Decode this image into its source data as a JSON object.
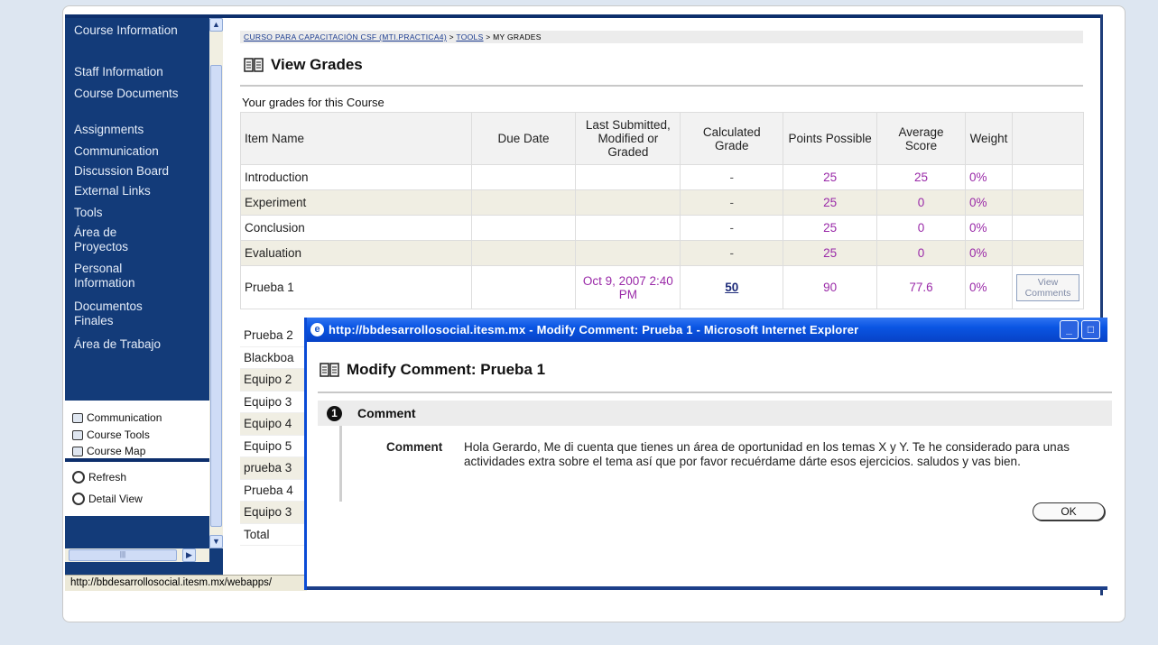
{
  "nav": {
    "course_items": [
      "Course Information",
      "Staff Information",
      "Course Documents",
      "Assignments",
      "Communication",
      "Discussion Board",
      "External Links",
      "Tools",
      "Área de Proyectos",
      "Personal Information",
      "Documentos Finales",
      "Área de Trabajo"
    ],
    "tool_items": [
      "Communication",
      "Course Tools",
      "Course Map"
    ],
    "tool_items2": [
      "Refresh",
      "Detail View"
    ]
  },
  "breadcrumb": {
    "course": "CURSO PARA CAPACITACIÓN CSF (MTI.PRACTICA4)",
    "sep1": " > ",
    "tools": "TOOLS",
    "sep2": " > MY GRADES"
  },
  "page_title": "View Grades",
  "grades_caption": "Your grades for this Course",
  "table": {
    "headers": [
      "Item Name",
      "Due Date",
      "Last Submitted, Modified or Graded",
      "Calculated Grade",
      "Points Possible",
      "Average Score",
      "Weight",
      ""
    ],
    "rows": [
      {
        "item": "Introduction",
        "due": "",
        "last": "",
        "grade": "-",
        "possible": "25",
        "average": "25",
        "weight": "0%"
      },
      {
        "item": "Experiment",
        "due": "",
        "last": "",
        "grade": "-",
        "possible": "25",
        "average": "0",
        "weight": "0%"
      },
      {
        "item": "Conclusion",
        "due": "",
        "last": "",
        "grade": "-",
        "possible": "25",
        "average": "0",
        "weight": "0%"
      },
      {
        "item": "Evaluation",
        "due": "",
        "last": "",
        "grade": "-",
        "possible": "25",
        "average": "0",
        "weight": "0%"
      },
      {
        "item": "Prueba 1",
        "due": "",
        "last": "Oct 9, 2007 2:40 PM",
        "grade": "50",
        "possible": "90",
        "average": "77.6",
        "weight": "0%",
        "action": "View Comments"
      }
    ],
    "partial_rows": [
      "Prueba 2",
      "Blackboa",
      "Equipo 2",
      "Equipo 3",
      "Equipo 4",
      "Equipo 5",
      "prueba 3",
      "Prueba 4",
      "Equipo 3",
      "Total"
    ]
  },
  "status_bar": "http://bbdesarrollosocial.itesm.mx/webapps/",
  "popup": {
    "window_title": "http://bbdesarrollosocial.itesm.mx - Modify Comment: Prueba 1 - Microsoft Internet Explorer",
    "heading": "Modify Comment: Prueba 1",
    "step": "1",
    "section": "Comment",
    "comment_label": "Comment",
    "comment_text": "Hola Gerardo, Me di cuenta que tienes un área de oportunidad en los temas X y Y. Te he considerado para unas actividades extra sobre el tema así que por favor recuérdame dárte esos ejercicios. saludos y vas bien.",
    "ok_label": "OK"
  },
  "colors": {
    "nav_bg": "#133b79",
    "link_purple": "#9a2aa8",
    "titlebar_blue": "#0a55e3"
  }
}
